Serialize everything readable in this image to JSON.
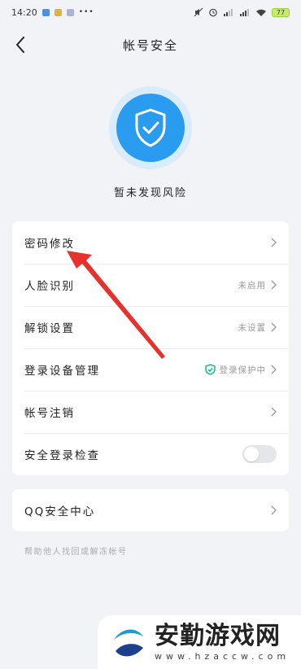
{
  "status_bar": {
    "time": "14:20",
    "more": "•••",
    "battery": "77"
  },
  "header": {
    "title": "帐号安全"
  },
  "status": {
    "text": "暂未发现风险"
  },
  "settings": [
    {
      "label": "密码修改",
      "value": ""
    },
    {
      "label": "人脸识别",
      "value": "未启用"
    },
    {
      "label": "解锁设置",
      "value": "未设置"
    },
    {
      "label": "登录设备管理",
      "value": "登录保护中"
    },
    {
      "label": "帐号注销",
      "value": ""
    },
    {
      "label": "安全登录检查",
      "toggle": false
    }
  ],
  "qq_center": {
    "label": "QQ安全中心"
  },
  "hint": "帮助他人找回或解冻帐号",
  "watermark": {
    "logo": "安勤游戏网",
    "url": "www.hzaccw.com"
  },
  "colors": {
    "accent": "#2a9cf0",
    "arrow": "#e5322d",
    "background": "#f2f3f7"
  }
}
